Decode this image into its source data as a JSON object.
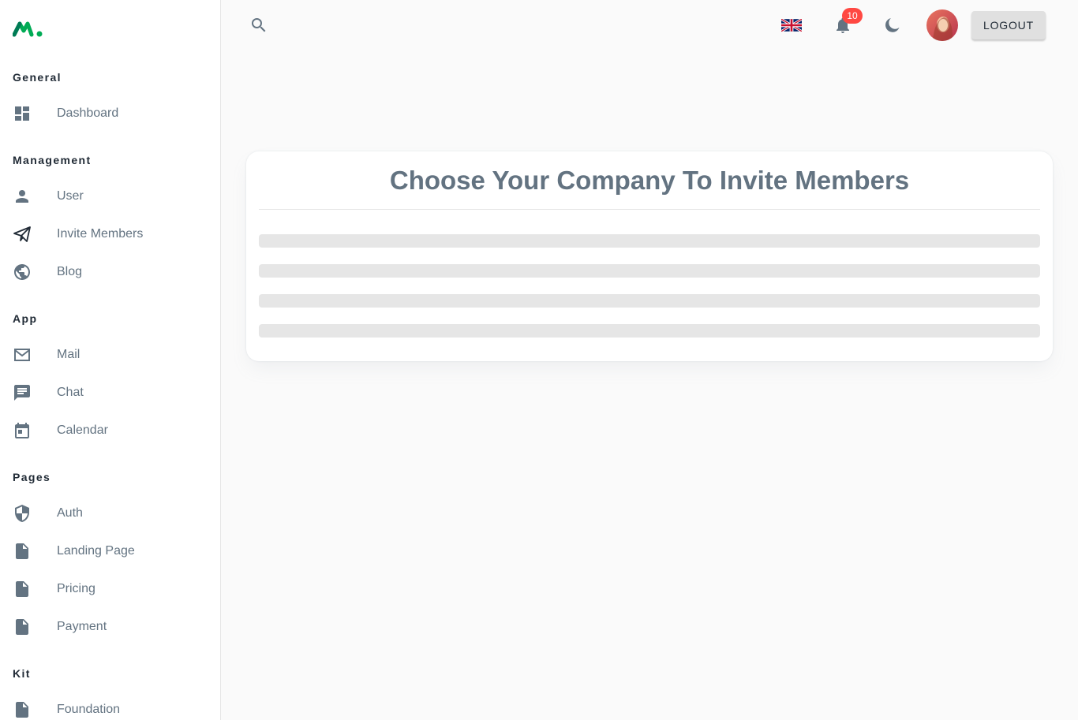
{
  "sidebar": {
    "sections": [
      {
        "title": "General",
        "items": [
          {
            "label": "Dashboard",
            "icon": "dashboard-icon"
          }
        ]
      },
      {
        "title": "Management",
        "items": [
          {
            "label": "User",
            "icon": "user-icon"
          },
          {
            "label": "Invite Members",
            "icon": "send-icon"
          },
          {
            "label": "Blog",
            "icon": "globe-icon"
          }
        ]
      },
      {
        "title": "App",
        "items": [
          {
            "label": "Mail",
            "icon": "mail-icon"
          },
          {
            "label": "Chat",
            "icon": "chat-icon"
          },
          {
            "label": "Calendar",
            "icon": "calendar-icon"
          }
        ]
      },
      {
        "title": "Pages",
        "items": [
          {
            "label": "Auth",
            "icon": "shield-icon"
          },
          {
            "label": "Landing Page",
            "icon": "file-icon"
          },
          {
            "label": "Pricing",
            "icon": "file-icon"
          },
          {
            "label": "Payment",
            "icon": "file-icon"
          }
        ]
      },
      {
        "title": "Kit",
        "items": [
          {
            "label": "Foundation",
            "icon": "file-icon"
          }
        ]
      }
    ]
  },
  "topbar": {
    "notifications_count": "10",
    "logout_label": "LOGOUT",
    "language_icon": "uk-flag-icon"
  },
  "main": {
    "card_title": "Choose Your Company To Invite Members",
    "skeleton_rows": 4
  },
  "colors": {
    "brand": "#00ab55",
    "text_secondary": "#637381",
    "badge": "#ff4842"
  }
}
